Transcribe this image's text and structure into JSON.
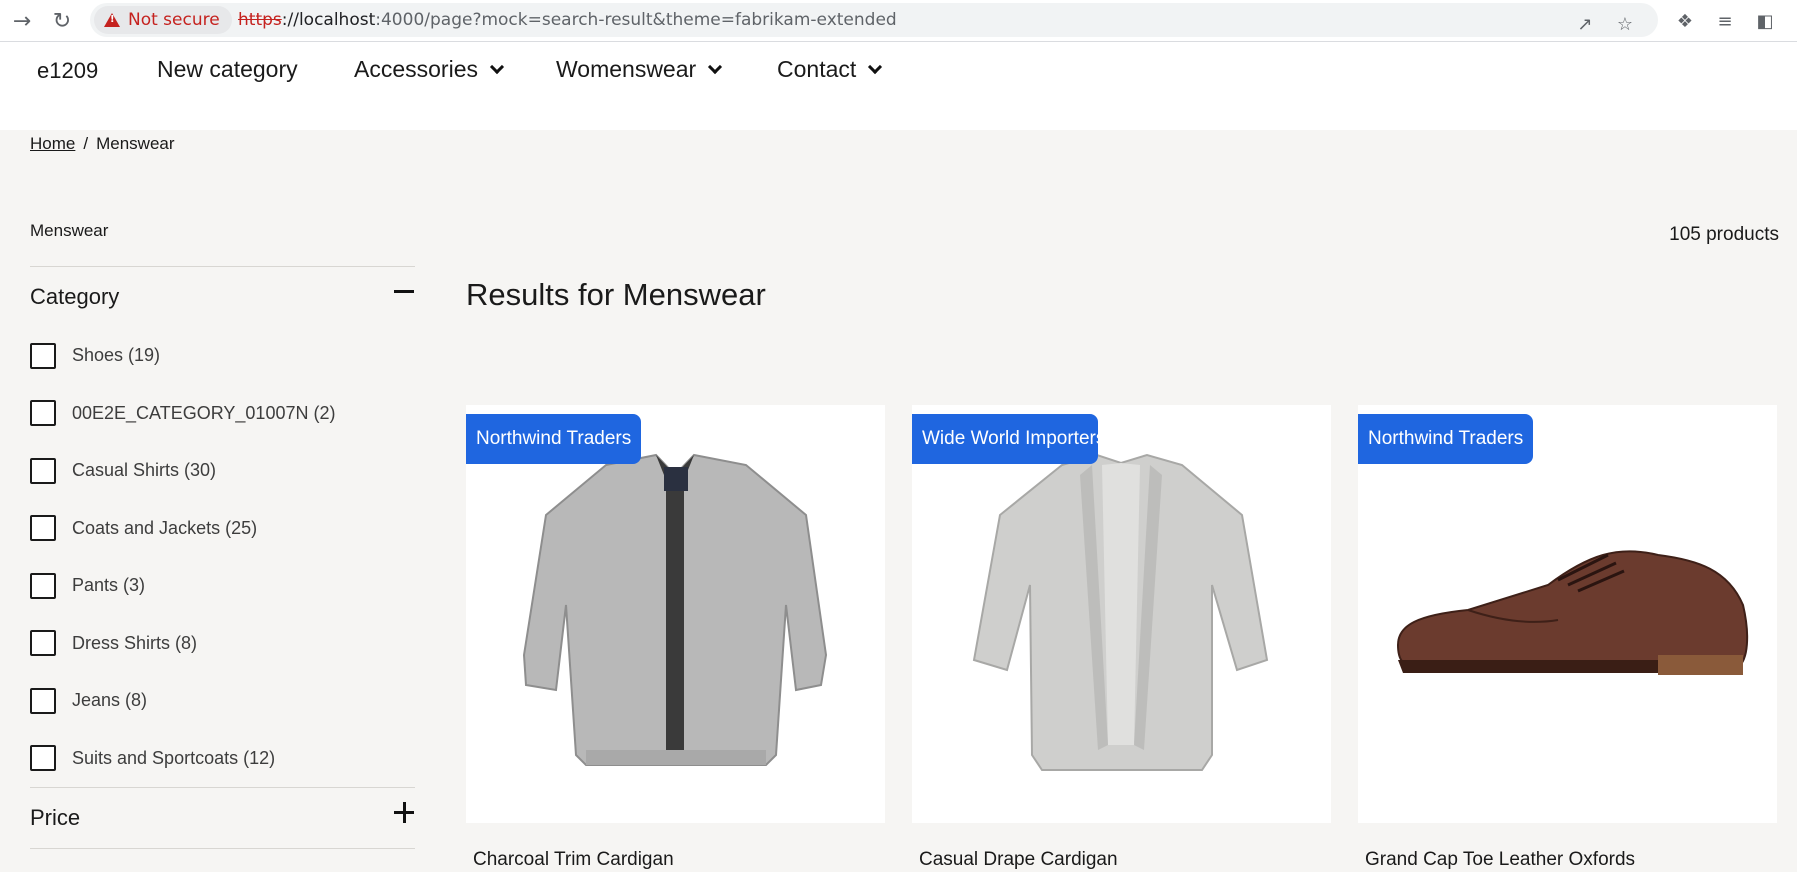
{
  "browser": {
    "security_label": "Not secure",
    "url_scheme": "https",
    "url_host": "://localhost",
    "url_rest": ":4000/page?mock=search-result&theme=fabrikam-extended"
  },
  "header": {
    "brand": "e1209",
    "nav": [
      {
        "label": "New category"
      },
      {
        "label": "Accessories"
      },
      {
        "label": "Womenswear"
      },
      {
        "label": "Contact"
      }
    ]
  },
  "breadcrumb": {
    "home": "Home",
    "separator": "/",
    "current": "Menswear"
  },
  "sidebar": {
    "title": "Menswear",
    "category": {
      "label": "Category",
      "options": [
        {
          "label": "Shoes (19)"
        },
        {
          "label": "00E2E_CATEGORY_01007N (2)"
        },
        {
          "label": "Casual Shirts (30)"
        },
        {
          "label": "Coats and Jackets (25)"
        },
        {
          "label": "Pants (3)"
        },
        {
          "label": "Dress Shirts (8)"
        },
        {
          "label": "Jeans (8)"
        },
        {
          "label": "Suits and Sportcoats (12)"
        }
      ]
    },
    "price": {
      "label": "Price"
    }
  },
  "main": {
    "product_count": "105 products",
    "results_title": "Results for Menswear",
    "products": [
      {
        "badge": "Northwind Traders",
        "name": "Charcoal Trim Cardigan"
      },
      {
        "badge": "Wide World Importers",
        "name": "Casual Drape Cardigan"
      },
      {
        "badge": "Northwind Traders",
        "name": "Grand Cap Toe Leather Oxfords"
      }
    ]
  },
  "colors": {
    "badge": "#1f66e0",
    "page_bg": "#f6f5f3",
    "warning": "#c5221f"
  }
}
